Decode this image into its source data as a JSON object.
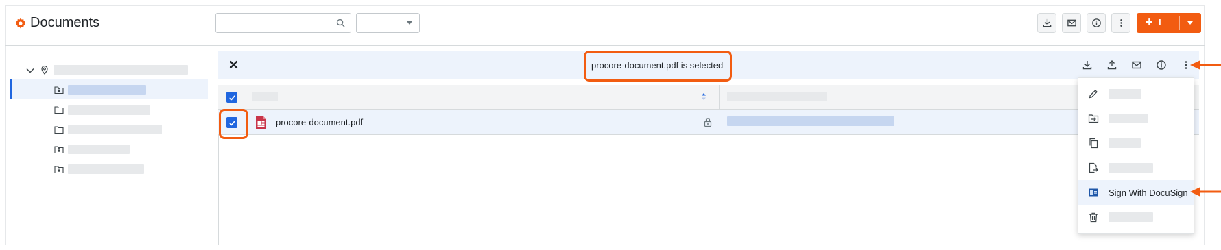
{
  "header": {
    "title": "Documents",
    "search": {
      "value": "",
      "placeholder": ""
    },
    "filter": {
      "selected": ""
    },
    "create_button": {
      "label": "I"
    }
  },
  "selection_bar": {
    "message": "procore-document.pdf is selected"
  },
  "table": {
    "rows": [
      {
        "name": "procore-document.pdf",
        "checked": true
      }
    ]
  },
  "row_menu": {
    "items": [
      {
        "icon": "pencil-icon",
        "label": ""
      },
      {
        "icon": "move-folder-icon",
        "label": ""
      },
      {
        "icon": "copy-icon",
        "label": ""
      },
      {
        "icon": "export-file-icon",
        "label": ""
      },
      {
        "icon": "docusign-icon",
        "label": "Sign With DocuSign"
      },
      {
        "icon": "trash-icon",
        "label": ""
      }
    ]
  },
  "colors": {
    "accent": "#f25c11",
    "selection": "#2066df",
    "row_highlight": "#edf3fc",
    "placeholder_bar": "#e7e9eb"
  }
}
